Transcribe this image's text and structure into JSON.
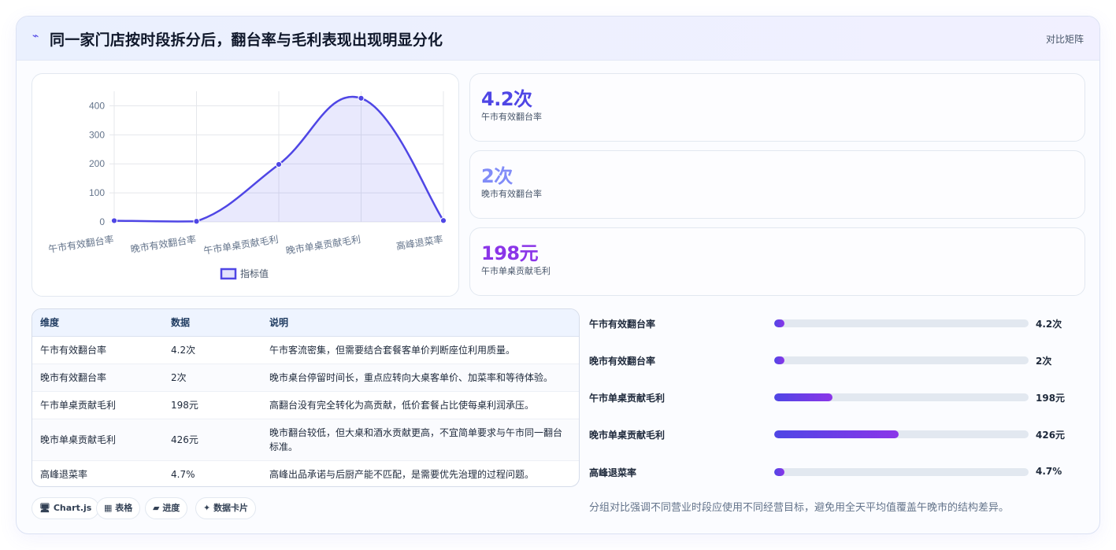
{
  "header": {
    "title": "同一家门店按时段拆分后，翻台率与毛利表现出现明显分化",
    "link": "对比矩阵",
    "icon": "trend-icon"
  },
  "chart_data": {
    "type": "line",
    "categories": [
      "午市有效翻台率",
      "晚市有效翻台率",
      "午市单桌贡献毛利",
      "晚市单桌贡献毛利",
      "高峰退菜率"
    ],
    "series": [
      {
        "name": "指标值",
        "values": [
          4.2,
          2,
          198,
          426,
          4.7
        ]
      }
    ],
    "ylim": [
      0,
      450
    ],
    "yticks": [
      0,
      100,
      200,
      300,
      400
    ],
    "grid": true,
    "legend": "bottom",
    "fill": true,
    "color": "#4f46e5"
  },
  "stats": [
    {
      "value": "4.2次",
      "label": "午市有效翻台率",
      "color": "#4f46e5"
    },
    {
      "value": "2次",
      "label": "晚市有效翻台率",
      "color": "#818cf8"
    },
    {
      "value": "198元",
      "label": "午市单桌贡献毛利",
      "color": "#8b35e8"
    }
  ],
  "table": {
    "headers": [
      "维度",
      "数据",
      "说明"
    ],
    "rows": [
      [
        "午市有效翻台率",
        "4.2次",
        "午市客流密集，但需要结合套餐客单价判断座位利用质量。"
      ],
      [
        "晚市有效翻台率",
        "2次",
        "晚市桌台停留时间长，重点应转向大桌客单价、加菜率和等待体验。"
      ],
      [
        "午市单桌贡献毛利",
        "198元",
        "高翻台没有完全转化为高贡献，低价套餐占比使每桌利润承压。"
      ],
      [
        "晚市单桌贡献毛利",
        "426元",
        "晚市翻台较低，但大桌和酒水贡献更高，不宜简单要求与午市同一翻台标准。"
      ],
      [
        "高峰退菜率",
        "4.7%",
        "高峰出品承诺与后厨产能不匹配，是需要优先治理的过程问题。"
      ]
    ]
  },
  "tags": [
    {
      "icon": "🖥",
      "label": "Chart.js"
    },
    {
      "icon": "▦",
      "label": "表格"
    },
    {
      "icon": "▰",
      "label": "进度"
    },
    {
      "icon": "✦",
      "label": "数据卡片"
    }
  ],
  "bars": [
    {
      "label": "午市有效翻台率",
      "value": "4.2次",
      "fraction": 0.04
    },
    {
      "label": "晚市有效翻台率",
      "value": "2次",
      "fraction": 0.04
    },
    {
      "label": "午市单桌贡献毛利",
      "value": "198元",
      "fraction": 0.23
    },
    {
      "label": "晚市单桌贡献毛利",
      "value": "426元",
      "fraction": 0.49
    },
    {
      "label": "高峰退菜率",
      "value": "4.7%",
      "fraction": 0.04
    }
  ],
  "footnote": "分组对比强调不同营业时段应使用不同经营目标，避免用全天平均值覆盖午晚市的结构差异。"
}
